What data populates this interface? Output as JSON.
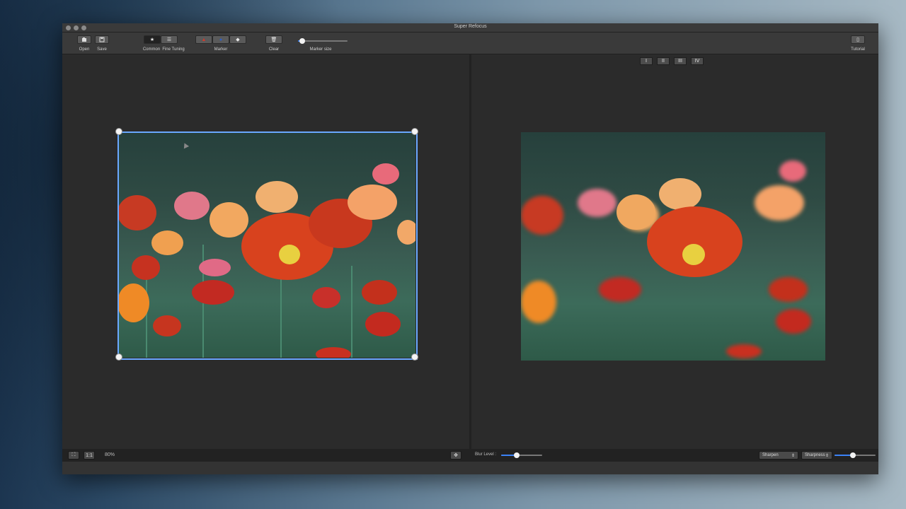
{
  "window": {
    "title": "Super Refocus"
  },
  "toolbar": {
    "open_label": "Open",
    "save_label": "Save",
    "common_label": "Common",
    "fine_tuning_label": "Fine Tuning",
    "marker_label": "Marker",
    "clear_label": "Clear",
    "marker_size_label": "Marker size",
    "marker_size_value": 0.1,
    "tutorial_label": "Tutorial",
    "icons": {
      "open": "open-icon",
      "save": "save-icon",
      "common": "star-icon",
      "fine_tuning": "list-icon",
      "marker_red": "triangle-icon",
      "marker_blue": "circle-icon",
      "marker_eraser": "eraser-icon",
      "clear": "trash-icon",
      "tutorial": "book-icon"
    }
  },
  "view_tabs": [
    "I",
    "II",
    "III",
    "IV"
  ],
  "left_status": {
    "fit_icon": "fullscreen-icon",
    "actual_size_label": "1:1",
    "zoom": "80%",
    "move_icon": "move-icon"
  },
  "right_status": {
    "blur_label": "Blur Level :",
    "blur_value": 0.4,
    "sharpen_select": "Sharpen",
    "sharpness_select": "Sharpness",
    "sharpness_value": 0.45
  },
  "colors": {
    "accent": "#3b82f6",
    "crop_frame": "#6aa8ff",
    "marker_red": "#d23a2c",
    "marker_blue": "#2f5fc4"
  }
}
